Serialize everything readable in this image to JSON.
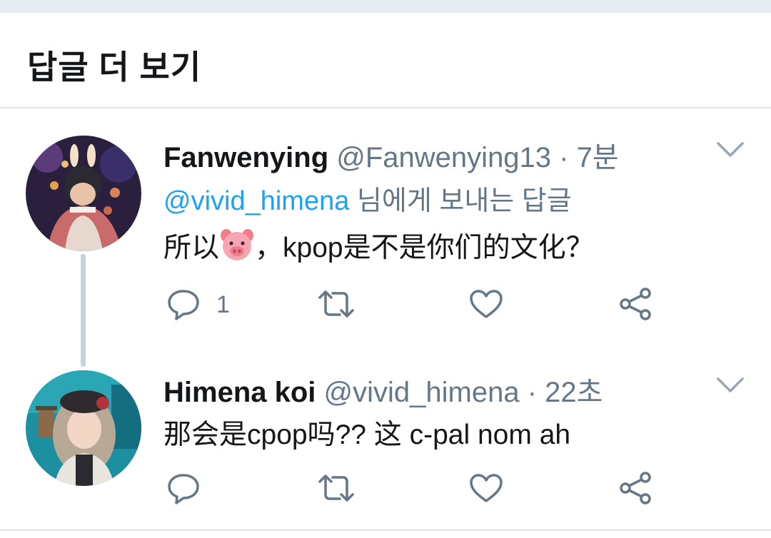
{
  "header": {
    "title": "답글 더 보기"
  },
  "tweets": [
    {
      "name": "Fanwenying",
      "handle": "@Fanwenying13",
      "separator": "·",
      "time": "7분",
      "reply_mention": "@vivid_himena",
      "reply_suffix": " 님에게 보내는 답글",
      "text_before_emoji": "所以",
      "emoji": "pig-face-emoji",
      "text_after_emoji": "，kpop是不是你们的文化？",
      "reply_count": "1"
    },
    {
      "name": "Himena koi",
      "handle": "@vivid_himena",
      "separator": "·",
      "time": "22초",
      "text": "那会是cpop吗?? 这 c-pal nom ah",
      "reply_count": ""
    }
  ],
  "icons": {
    "reply": "reply-bubble-icon",
    "retweet": "retweet-icon",
    "like": "heart-icon",
    "share": "share-icon",
    "menu": "chevron-down-icon"
  },
  "colors": {
    "text": "#14171a",
    "secondary": "#657786",
    "link": "#1da1f2",
    "divider": "#dfe3e6",
    "thread_line": "#c7d3dc"
  }
}
